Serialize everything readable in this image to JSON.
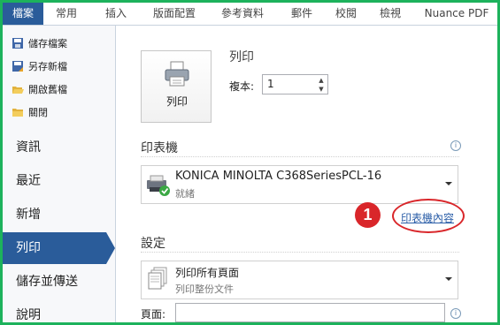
{
  "ribbon": {
    "file_tab": "檔案",
    "tabs": [
      "常用",
      "插入",
      "版面配置",
      "參考資料",
      "郵件",
      "校閱",
      "檢視",
      "Nuance PDF"
    ]
  },
  "sidebar": {
    "commands": [
      {
        "label": "儲存檔案",
        "icon": "save-icon"
      },
      {
        "label": "另存新檔",
        "icon": "save-as-icon"
      },
      {
        "label": "開啟舊檔",
        "icon": "open-folder-icon"
      },
      {
        "label": "關閉",
        "icon": "close-folder-icon"
      }
    ],
    "nav": [
      "資訊",
      "最近",
      "新增",
      "列印",
      "儲存並傳送",
      "說明"
    ],
    "active": "列印"
  },
  "print": {
    "button_label": "列印",
    "heading": "列印",
    "copies_label": "複本:",
    "copies_value": "1"
  },
  "printer": {
    "heading": "印表機",
    "name": "KONICA MINOLTA C368SeriesPCL-16",
    "status": "就緒",
    "properties_link": "印表機內容"
  },
  "annotation": {
    "number": "1",
    "color": "#d9262a"
  },
  "settings": {
    "heading": "設定",
    "option_title": "列印所有頁面",
    "option_subtitle": "列印整份文件",
    "pages_label": "頁面:"
  },
  "colors": {
    "accent": "#2a5c9a",
    "frame": "#1db25c",
    "link": "#2b5ea8"
  }
}
